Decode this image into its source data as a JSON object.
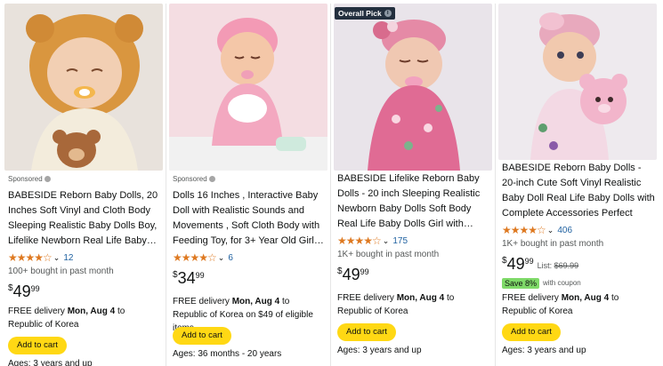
{
  "products": [
    {
      "sponsored": "Sponsored",
      "badge": "",
      "title": "BABESIDE Reborn Baby Dolls, 20 Inches Soft Vinyl and Cloth Body Sleeping Realistic Baby Dolls Boy, Lifelike Newborn Real Life Baby…",
      "stars": "★★★★☆",
      "rating_value": 4.5,
      "review_count": "12",
      "bought": "100+ bought in past month",
      "price": {
        "currency": "$",
        "whole": "49",
        "fraction": "99",
        "list_label": "",
        "list_price": ""
      },
      "deal": {
        "save": "",
        "coupon": ""
      },
      "delivery_prefix": "FREE delivery ",
      "delivery_date": "Mon, Aug 4",
      "delivery_suffix": " to Republic of Korea",
      "cart_label": "Add to cart",
      "ages": "Ages: 3 years and up",
      "image_icon": "reborn-doll-lion-hood-image"
    },
    {
      "sponsored": "Sponsored",
      "badge": "",
      "title": "Dolls 16 Inches , Interactive Baby Doll with Realistic Sounds and Movements  , Soft Cloth Body with Feeding Toy, for 3+ Year Old Girl…",
      "stars": "★★★★☆",
      "rating_value": 4.0,
      "review_count": "6",
      "bought": "",
      "price": {
        "currency": "$",
        "whole": "34",
        "fraction": "99",
        "list_label": "",
        "list_price": ""
      },
      "deal": {
        "save": "",
        "coupon": ""
      },
      "delivery_prefix": "FREE delivery ",
      "delivery_date": "Mon, Aug 4",
      "delivery_suffix": " to Republic of Korea on $49 of eligible items",
      "cart_label": "Add to cart",
      "ages": "Ages: 36 months - 20 years",
      "image_icon": "interactive-doll-pink-image"
    },
    {
      "sponsored": "",
      "badge": "Overall Pick",
      "title": "BABESIDE Lifelike Reborn Baby Dolls - 20 inch Sleeping Realistic Newborn Baby Dolls Soft Body Real Life Baby Dolls Girl with…",
      "stars": "★★★★☆",
      "rating_value": 4.5,
      "review_count": "175",
      "bought": "1K+ bought in past month",
      "price": {
        "currency": "$",
        "whole": "49",
        "fraction": "99",
        "list_label": "",
        "list_price": ""
      },
      "deal": {
        "save": "",
        "coupon": ""
      },
      "delivery_prefix": "FREE delivery ",
      "delivery_date": "Mon, Aug 4",
      "delivery_suffix": " to Republic of Korea",
      "cart_label": "Add to cart",
      "ages": "Ages: 3 years and up",
      "image_icon": "sleeping-doll-floral-image"
    },
    {
      "sponsored": "",
      "badge": "",
      "title": "BABESIDE Reborn Baby Dolls - 20-inch Cute Soft Vinyl Realistic Baby Doll Real Life Baby Dolls with Complete Accessories Perfect for…",
      "stars": "★★★★☆",
      "rating_value": 4.5,
      "review_count": "406",
      "bought": "1K+ bought in past month",
      "price": {
        "currency": "$",
        "whole": "49",
        "fraction": "99",
        "list_label": "List: ",
        "list_price": "$69.99"
      },
      "deal": {
        "save": "Save 8%",
        "coupon": "with coupon"
      },
      "delivery_prefix": "FREE delivery ",
      "delivery_date": "Mon, Aug 4",
      "delivery_suffix": " to Republic of Korea",
      "cart_label": "Add to cart",
      "ages": "Ages: 3 years and up",
      "image_icon": "doll-with-teddy-bear-image"
    }
  ],
  "colors": {
    "star": "#de7921",
    "link": "#2162a1",
    "cart_button": "#ffd814",
    "save_badge": "#7fda69",
    "overall_badge": "#232f3e"
  }
}
